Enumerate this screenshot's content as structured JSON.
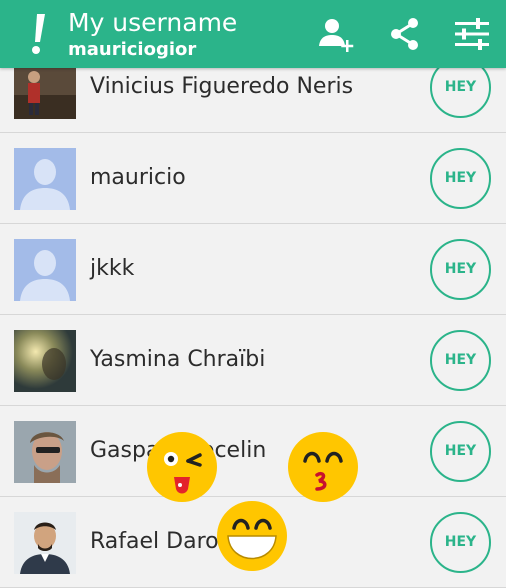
{
  "header": {
    "title": "My username",
    "subtitle": "mauriciogior",
    "icons": [
      "exclamation-logo-icon",
      "add-user-icon",
      "share-icon",
      "settings-sliders-icon"
    ]
  },
  "colors": {
    "accent": "#2bb48a",
    "background": "#f2f2f2",
    "emoji_yellow": "#ffc600"
  },
  "list": {
    "hey_label": "HEY",
    "items": [
      {
        "name": "Vinicius Figueredo Neris",
        "avatar": "photo"
      },
      {
        "name": "mauricio",
        "avatar": "default-silhouette"
      },
      {
        "name": "jkkk",
        "avatar": "default-silhouette"
      },
      {
        "name": "Yasmina Chraïbi",
        "avatar": "photo"
      },
      {
        "name": "Gaspard Lecelin",
        "avatar": "photo"
      },
      {
        "name": "Rafael Daron",
        "avatar": "photo"
      }
    ]
  },
  "emojis": [
    "winking-tongue-emoji-icon",
    "kissing-emoji-icon",
    "grinning-emoji-icon"
  ]
}
